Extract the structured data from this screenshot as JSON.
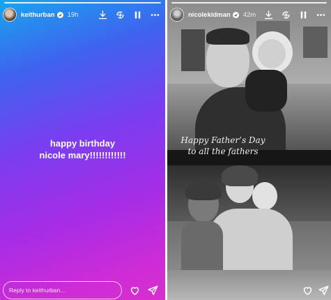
{
  "left_story": {
    "username": "keithurban",
    "timestamp": "19h",
    "caption_line1": "happy birthday",
    "caption_line2": "nicole mary!!!!!!!!!!!!",
    "reply_placeholder": "Reply to keithurban...",
    "header_icons": [
      "download-icon",
      "add-to-story-icon",
      "pause-icon",
      "more-options-icon"
    ],
    "footer_icons": [
      "heart-icon",
      "send-icon"
    ]
  },
  "right_story": {
    "username": "nicolekidman",
    "timestamp": "42m",
    "text_line1": "Happy Father’s Day",
    "text_line2": "to all the fathers",
    "header_icons": [
      "download-icon",
      "add-to-story-icon",
      "pause-icon",
      "more-options-icon"
    ],
    "footer_icons": [
      "heart-icon",
      "send-icon"
    ]
  },
  "colors": {
    "gradient_top": "#17a6ee",
    "gradient_mid": "#7a3ef0",
    "gradient_bottom": "#d72fcf",
    "text": "#ffffff"
  }
}
